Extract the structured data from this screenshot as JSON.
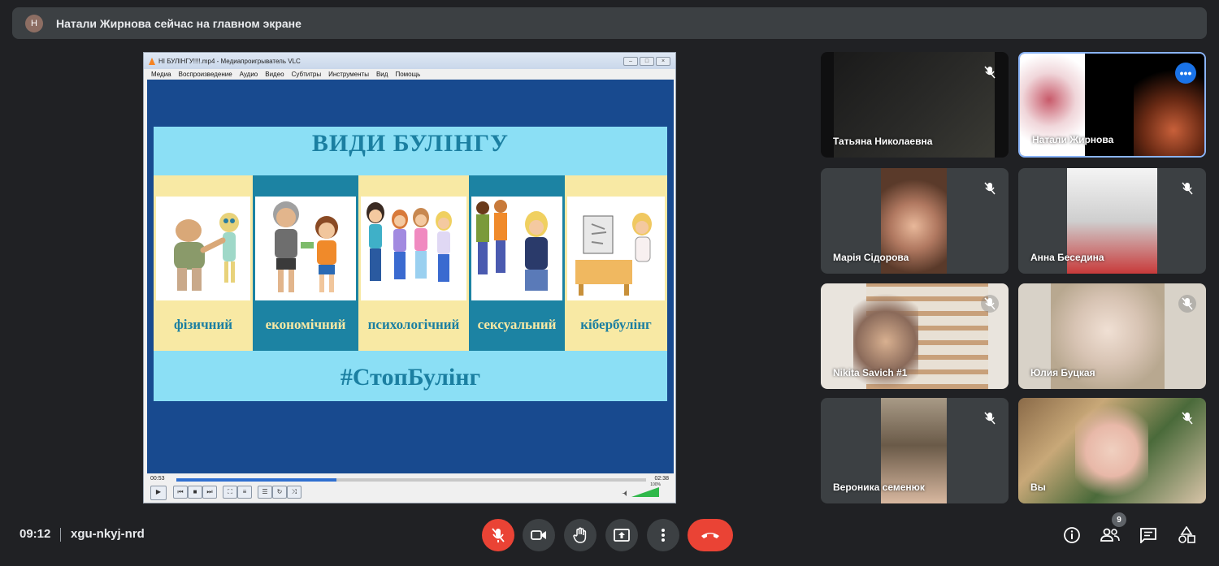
{
  "banner": {
    "avatar_letter": "Н",
    "text": "Натали Жирнова сейчас на главном экране"
  },
  "vlc": {
    "title": "НІ БУЛІНГУ!!!!.mp4 - Медиапроигрыватель VLC",
    "menu": [
      "Медиа",
      "Воспроизведение",
      "Аудио",
      "Видео",
      "Субтитры",
      "Инструменты",
      "Вид",
      "Помощь"
    ],
    "time_elapsed": "00:53",
    "time_total": "02:38",
    "progress": 0.34,
    "volume_label": "100%",
    "volume": 1.0
  },
  "slide": {
    "title": "ВИДИ БУЛІНГУ",
    "types": [
      "фізичний",
      "економічний",
      "психологічний",
      "сексуальний",
      "кібербулінг"
    ],
    "hashtag": "#СтопБулінг"
  },
  "participants": [
    {
      "name": "Татьяна Николаевна",
      "muted": true
    },
    {
      "name": "Натали Жирнова",
      "presenting": true
    },
    {
      "name": "Марія Сідорова",
      "muted": true
    },
    {
      "name": "Анна Беседина",
      "muted": true
    },
    {
      "name": "Nikita Savich #1",
      "muted": true
    },
    {
      "name": "Юлия Буцкая",
      "muted": true
    },
    {
      "name": "Вероника семенюк",
      "muted": true
    },
    {
      "name": "Вы",
      "muted": true
    }
  ],
  "bottom": {
    "time": "09:12",
    "meeting_code": "xgu-nkyj-nrd",
    "participant_count": "9"
  },
  "colors": {
    "end_call": "#ea4335",
    "accent": "#1a73e8",
    "bg": "#202124"
  }
}
